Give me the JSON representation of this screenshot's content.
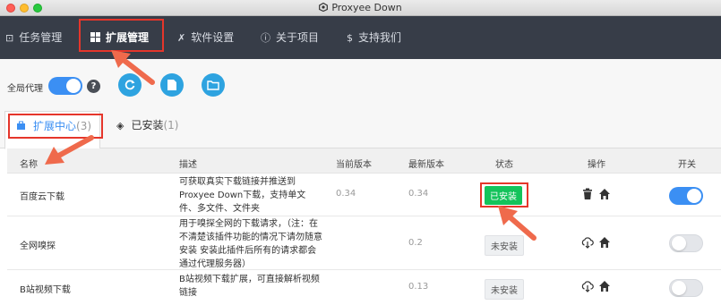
{
  "window": {
    "title": "Proxyee Down"
  },
  "nav": {
    "items": [
      {
        "label": "任务管理",
        "icon": "download-square-icon",
        "active": false
      },
      {
        "label": "扩展管理",
        "icon": "windows-icon",
        "active": true
      },
      {
        "label": "软件设置",
        "icon": "tools-icon",
        "active": false
      },
      {
        "label": "关于项目",
        "icon": "info-icon",
        "active": false
      },
      {
        "label": "支持我们",
        "icon": "dollar-icon",
        "active": false
      }
    ]
  },
  "toolbar": {
    "proxy_label": "全局代理",
    "proxy_enabled": true,
    "help_glyph": "?"
  },
  "tabs": [
    {
      "label": "扩展中心",
      "count": "(3)",
      "icon": "store-icon",
      "active": true
    },
    {
      "label": "已安装",
      "count": "(1)",
      "icon": "layers-icon",
      "active": false
    }
  ],
  "table": {
    "headers": [
      "名称",
      "描述",
      "当前版本",
      "最新版本",
      "状态",
      "操作",
      "开关"
    ],
    "rows": [
      {
        "name": "百度云下载",
        "desc": "可获取真实下载链接并推送到Proxyee Down下载，支持单文件、多文件、文件夹",
        "current": "0.34",
        "latest": "0.34",
        "status": "已安装",
        "installed": true,
        "enabled": true
      },
      {
        "name": "全网嗅探",
        "desc": "用于嗅探全网的下载请求，（注：在不清楚该插件功能的情况下请勿随意安装 安装此插件后所有的请求都会通过代理服务器）",
        "current": "",
        "latest": "0.2",
        "status": "未安装",
        "installed": false,
        "enabled": false
      },
      {
        "name": "B站视频下载",
        "desc": "B站视频下载扩展，可直接解析视频链接",
        "current": "",
        "latest": "0.13",
        "status": "未安装",
        "installed": false,
        "enabled": false
      }
    ]
  },
  "colors": {
    "nav_bg": "#373d48",
    "accent": "#3b8ff3",
    "installed_green": "#13c35b",
    "annotation_red": "#e5362b",
    "arrow_orange": "#ef6a4c"
  }
}
